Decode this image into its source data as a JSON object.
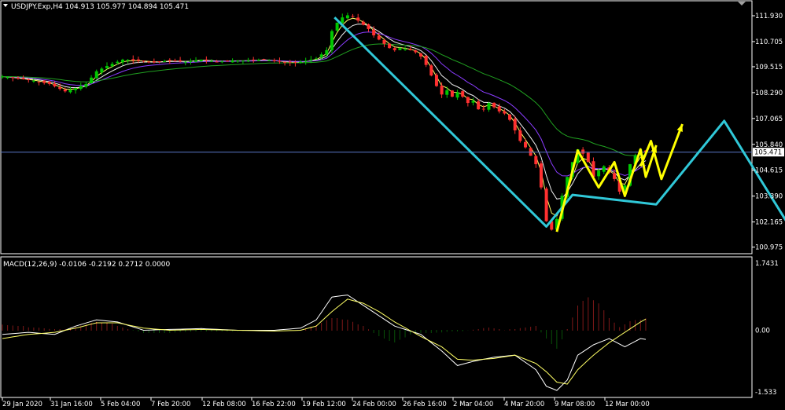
{
  "colors": {
    "background": "#000000",
    "frame": "#ffffff",
    "bull_candle": "#00c800",
    "bear_candle": "#ff3030",
    "ma_fast": "#ffff66",
    "ma_mid": "#f0f0f0",
    "ma_purple": "#8a3cff",
    "ma_green": "#20a020",
    "cyan_arrow": "#30c8d8",
    "yellow_arrow": "#ffff00",
    "macd_pos": "#ff3030",
    "macd_neg": "#10a010",
    "macd_line": "#ffffff",
    "signal_line": "#ffff66",
    "price_label_bg": "#ffffff",
    "price_label_text": "#000000",
    "current_line": "#5a78c8"
  },
  "header": {
    "arrow_icon": "triangle-down-icon",
    "text": "USDJPY.Exp,H4  104.913 105.977 104.894 105.471"
  },
  "macd_header": {
    "text": "MACD(12,26,9) -0.0106 -0.2192 0.2712 0.0000"
  },
  "price_axis": {
    "labels": [
      "111.930",
      "110.705",
      "109.515",
      "108.290",
      "107.065",
      "105.840",
      "104.615",
      "103.390",
      "102.165",
      "100.975"
    ],
    "current_price": "105.471"
  },
  "macd_axis": {
    "labels": [
      "1.7431",
      "0.00",
      "-1.533"
    ]
  },
  "time_axis": {
    "labels": [
      "29 Jan 2020",
      "31 Jan 16:00",
      "5 Feb 04:00",
      "7 Feb 20:00",
      "12 Feb 08:00",
      "16 Feb 22:00",
      "19 Feb 12:00",
      "24 Feb 00:00",
      "26 Feb 16:00",
      "2 Mar 04:00",
      "4 Mar 20:00",
      "9 Mar 08:00",
      "12 Mar 00:00"
    ]
  },
  "chart_data": {
    "type": "candlestick",
    "symbol": "USDJPY.Exp",
    "timeframe": "H4",
    "ohlc_last": {
      "open": 104.913,
      "high": 105.977,
      "low": 104.894,
      "close": 105.471
    },
    "ylim": [
      100.7,
      112.6
    ],
    "price_path": [
      [
        0,
        109.05
      ],
      [
        3,
        108.95
      ],
      [
        6,
        108.85
      ],
      [
        9,
        108.7
      ],
      [
        12,
        108.35
      ],
      [
        14,
        108.5
      ],
      [
        16,
        108.7
      ],
      [
        18,
        109.3
      ],
      [
        20,
        109.55
      ],
      [
        23,
        109.85
      ],
      [
        26,
        109.8
      ],
      [
        29,
        109.72
      ],
      [
        32,
        109.8
      ],
      [
        35,
        109.75
      ],
      [
        38,
        109.85
      ],
      [
        41,
        109.75
      ],
      [
        44,
        109.8
      ],
      [
        47,
        109.8
      ],
      [
        50,
        109.85
      ],
      [
        53,
        109.75
      ],
      [
        56,
        109.7
      ],
      [
        58,
        109.8
      ],
      [
        60,
        109.9
      ],
      [
        62,
        110.3
      ],
      [
        63,
        111.2
      ],
      [
        64,
        111.6
      ],
      [
        65,
        111.85
      ],
      [
        66,
        111.95
      ],
      [
        67,
        111.9
      ],
      [
        68,
        111.7
      ],
      [
        69,
        111.5
      ],
      [
        70,
        111.3
      ],
      [
        71,
        111.0
      ],
      [
        72,
        110.8
      ],
      [
        73,
        110.6
      ],
      [
        74,
        110.4
      ],
      [
        75,
        110.3
      ],
      [
        76,
        110.4
      ],
      [
        77,
        110.35
      ],
      [
        78,
        110.3
      ],
      [
        79,
        110.2
      ],
      [
        80,
        110.0
      ],
      [
        81,
        109.6
      ],
      [
        82,
        109.1
      ],
      [
        83,
        108.6
      ],
      [
        84,
        108.2
      ],
      [
        85,
        108.4
      ],
      [
        86,
        108.1
      ],
      [
        87,
        108.3
      ],
      [
        88,
        108.1
      ],
      [
        89,
        107.8
      ],
      [
        90,
        107.9
      ],
      [
        91,
        107.5
      ],
      [
        92,
        107.5
      ],
      [
        93,
        107.8
      ],
      [
        94,
        107.6
      ],
      [
        95,
        107.4
      ],
      [
        96,
        107.3
      ],
      [
        97,
        107.0
      ],
      [
        98,
        106.5
      ],
      [
        99,
        106.0
      ],
      [
        100,
        105.7
      ],
      [
        101,
        105.3
      ],
      [
        102,
        104.9
      ],
      [
        103,
        103.8
      ],
      [
        104,
        102.2
      ],
      [
        105,
        101.8
      ],
      [
        106,
        102.3
      ],
      [
        107,
        103.4
      ],
      [
        108,
        104.3
      ],
      [
        109,
        105.0
      ],
      [
        110,
        105.6
      ],
      [
        111,
        105.4
      ],
      [
        112,
        105.0
      ],
      [
        113,
        104.3
      ],
      [
        114,
        104.6
      ],
      [
        115,
        104.8
      ],
      [
        116,
        104.5
      ],
      [
        117,
        104.2
      ],
      [
        118,
        103.6
      ],
      [
        119,
        103.9
      ],
      [
        120,
        104.9
      ],
      [
        121,
        105.3
      ],
      [
        122,
        105.6
      ],
      [
        123,
        105.47
      ]
    ],
    "indicators": [
      {
        "name": "MA fast",
        "color_key": "ma_fast"
      },
      {
        "name": "MA mid",
        "color_key": "ma_mid"
      },
      {
        "name": "MA purple",
        "color_key": "ma_purple"
      },
      {
        "name": "MA green",
        "color_key": "ma_green"
      }
    ],
    "annotations": {
      "cyan_path": [
        [
          63.5,
          111.85
        ],
        [
          104,
          101.95
        ],
        [
          109,
          103.45
        ],
        [
          125,
          103.0
        ],
        [
          138,
          106.95
        ],
        [
          153,
          100.95
        ]
      ],
      "yellow_paths": [
        [
          [
            106,
            101.7
          ],
          [
            110,
            105.55
          ],
          [
            114,
            103.8
          ],
          [
            117,
            105.0
          ],
          [
            119,
            103.4
          ],
          [
            122,
            105.6
          ],
          [
            123,
            104.3
          ],
          [
            125,
            105.8
          ]
        ],
        [
          [
            122,
            104.8
          ],
          [
            124,
            106.0
          ],
          [
            126,
            104.2
          ],
          [
            130,
            106.8
          ]
        ]
      ]
    },
    "macd": {
      "params": "12,26,9",
      "values": {
        "histogram": -0.0106,
        "macd": -0.2192,
        "signal": 0.2712,
        "extra": 0.0
      },
      "ylim": [
        -1.6,
        1.75
      ],
      "hist": [
        [
          0,
          0.13
        ],
        [
          3,
          0.11
        ],
        [
          6,
          0.06
        ],
        [
          9,
          0.04
        ],
        [
          12,
          0.02
        ],
        [
          15,
          0.12
        ],
        [
          18,
          0.2
        ],
        [
          21,
          0.16
        ],
        [
          24,
          0.02
        ],
        [
          27,
          -0.06
        ],
        [
          30,
          -0.07
        ],
        [
          33,
          -0.05
        ],
        [
          36,
          -0.04
        ],
        [
          39,
          -0.03
        ],
        [
          42,
          -0.02
        ],
        [
          45,
          -0.02
        ],
        [
          48,
          -0.01
        ],
        [
          51,
          -0.02
        ],
        [
          54,
          -0.02
        ],
        [
          57,
          0.01
        ],
        [
          60,
          0.12
        ],
        [
          63,
          0.3
        ],
        [
          66,
          0.25
        ],
        [
          69,
          0.1
        ],
        [
          72,
          -0.15
        ],
        [
          75,
          -0.3
        ],
        [
          78,
          -0.1
        ],
        [
          81,
          -0.06
        ],
        [
          84,
          -0.05
        ],
        [
          87,
          -0.03
        ],
        [
          90,
          0.01
        ],
        [
          93,
          0.07
        ],
        [
          96,
          0.0
        ],
        [
          99,
          0.05
        ],
        [
          102,
          0.1
        ],
        [
          104,
          -0.2
        ],
        [
          106,
          -0.45
        ],
        [
          108,
          0.02
        ],
        [
          110,
          0.6
        ],
        [
          112,
          0.8
        ],
        [
          114,
          0.65
        ],
        [
          116,
          0.3
        ],
        [
          118,
          0.08
        ],
        [
          120,
          0.22
        ],
        [
          123,
          0.28
        ]
      ],
      "macd_line": [
        [
          0,
          -0.1
        ],
        [
          5,
          -0.05
        ],
        [
          10,
          -0.1
        ],
        [
          14,
          0.1
        ],
        [
          18,
          0.25
        ],
        [
          22,
          0.2
        ],
        [
          27,
          0.0
        ],
        [
          32,
          0.02
        ],
        [
          38,
          0.04
        ],
        [
          45,
          0.0
        ],
        [
          52,
          0.0
        ],
        [
          57,
          0.05
        ],
        [
          60,
          0.25
        ],
        [
          63,
          0.8
        ],
        [
          66,
          0.85
        ],
        [
          69,
          0.6
        ],
        [
          72,
          0.35
        ],
        [
          75,
          0.1
        ],
        [
          80,
          -0.1
        ],
        [
          84,
          -0.5
        ],
        [
          87,
          -0.85
        ],
        [
          90,
          -0.75
        ],
        [
          94,
          -0.65
        ],
        [
          98,
          -0.6
        ],
        [
          102,
          -0.95
        ],
        [
          104,
          -1.35
        ],
        [
          106,
          -1.45
        ],
        [
          108,
          -1.2
        ],
        [
          110,
          -0.6
        ],
        [
          113,
          -0.35
        ],
        [
          116,
          -0.2
        ],
        [
          119,
          -0.4
        ],
        [
          122,
          -0.2
        ],
        [
          123,
          -0.22
        ]
      ],
      "signal_line": [
        [
          0,
          -0.2
        ],
        [
          5,
          -0.1
        ],
        [
          10,
          -0.05
        ],
        [
          14,
          0.05
        ],
        [
          18,
          0.18
        ],
        [
          22,
          0.18
        ],
        [
          27,
          0.05
        ],
        [
          32,
          0.0
        ],
        [
          38,
          0.02
        ],
        [
          45,
          0.0
        ],
        [
          52,
          -0.02
        ],
        [
          57,
          0.0
        ],
        [
          60,
          0.1
        ],
        [
          63,
          0.45
        ],
        [
          66,
          0.75
        ],
        [
          69,
          0.65
        ],
        [
          72,
          0.45
        ],
        [
          75,
          0.2
        ],
        [
          80,
          -0.15
        ],
        [
          84,
          -0.4
        ],
        [
          87,
          -0.7
        ],
        [
          90,
          -0.72
        ],
        [
          94,
          -0.68
        ],
        [
          98,
          -0.6
        ],
        [
          102,
          -0.8
        ],
        [
          104,
          -1.0
        ],
        [
          106,
          -1.25
        ],
        [
          108,
          -1.3
        ],
        [
          110,
          -0.95
        ],
        [
          113,
          -0.6
        ],
        [
          116,
          -0.3
        ],
        [
          119,
          -0.05
        ],
        [
          122,
          0.2
        ],
        [
          123,
          0.27
        ]
      ]
    }
  }
}
